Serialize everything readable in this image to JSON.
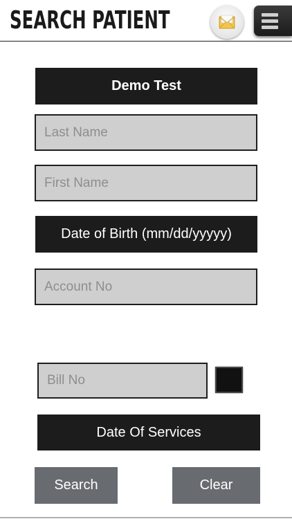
{
  "header": {
    "title": "SEARCH PATIENT",
    "mail_icon": "mail-icon",
    "menu_icon": "hamburger-menu-icon"
  },
  "form": {
    "provider_label": "Demo Test",
    "last_name_placeholder": "Last Name",
    "first_name_placeholder": "First Name",
    "dob_label": "Date of Birth (mm/dd/yyyyy)",
    "account_no_placeholder": "Account No",
    "bill_no_placeholder": "Bill No",
    "date_of_services_label": "Date Of Services",
    "search_label": "Search",
    "clear_label": "Clear"
  },
  "colors": {
    "bar_dark": "#1c1c1c",
    "input_bg": "#cfcfcf",
    "button_gray": "#686b70"
  }
}
